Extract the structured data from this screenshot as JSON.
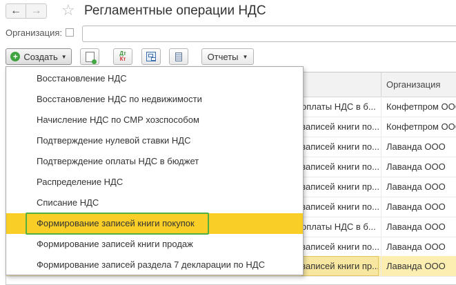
{
  "window": {
    "title": "Регламентные операции НДС"
  },
  "filter": {
    "label": "Организация:",
    "value": ""
  },
  "toolbar": {
    "create_label": "Создать",
    "reports_label": "Отчеты",
    "dtkt_top": "Дт",
    "dtkt_bottom": "Кт"
  },
  "table": {
    "columns": [
      "Организация"
    ],
    "rows": [
      {
        "doc": "оплаты НДС в б...",
        "org": "Конфетпром ООО"
      },
      {
        "doc": "записей книги по...",
        "org": "Конфетпром ООО"
      },
      {
        "doc": "записей книги по...",
        "org": "Лаванда ООО"
      },
      {
        "doc": "записей книги по...",
        "org": "Лаванда ООО"
      },
      {
        "doc": "записей книги пр...",
        "org": "Лаванда ООО"
      },
      {
        "doc": "записей книги по...",
        "org": "Лаванда ООО"
      },
      {
        "doc": "оплаты НДС в б...",
        "org": "Лаванда ООО"
      },
      {
        "doc": "записей книги по...",
        "org": "Лаванда ООО"
      },
      {
        "doc": "записей книги пр...",
        "org": "Лаванда ООО"
      }
    ]
  },
  "create_menu": {
    "items": [
      "Восстановление НДС",
      "Восстановление НДС по недвижимости",
      "Начисление НДС по СМР хозспособом",
      "Подтверждение нулевой ставки НДС",
      "Подтверждение оплаты НДС в бюджет",
      "Распределение НДС",
      "Списание НДС",
      "Формирование записей книги покупок",
      "Формирование записей книги продаж",
      "Формирование записей раздела 7 декларации по НДС"
    ],
    "highlighted_index": 7
  },
  "colors": {
    "menu_highlight": "#f9cf27",
    "highlight_frame": "#52b043",
    "selected_row": "#fbeeb0",
    "create_icon": "#3fa33f"
  }
}
